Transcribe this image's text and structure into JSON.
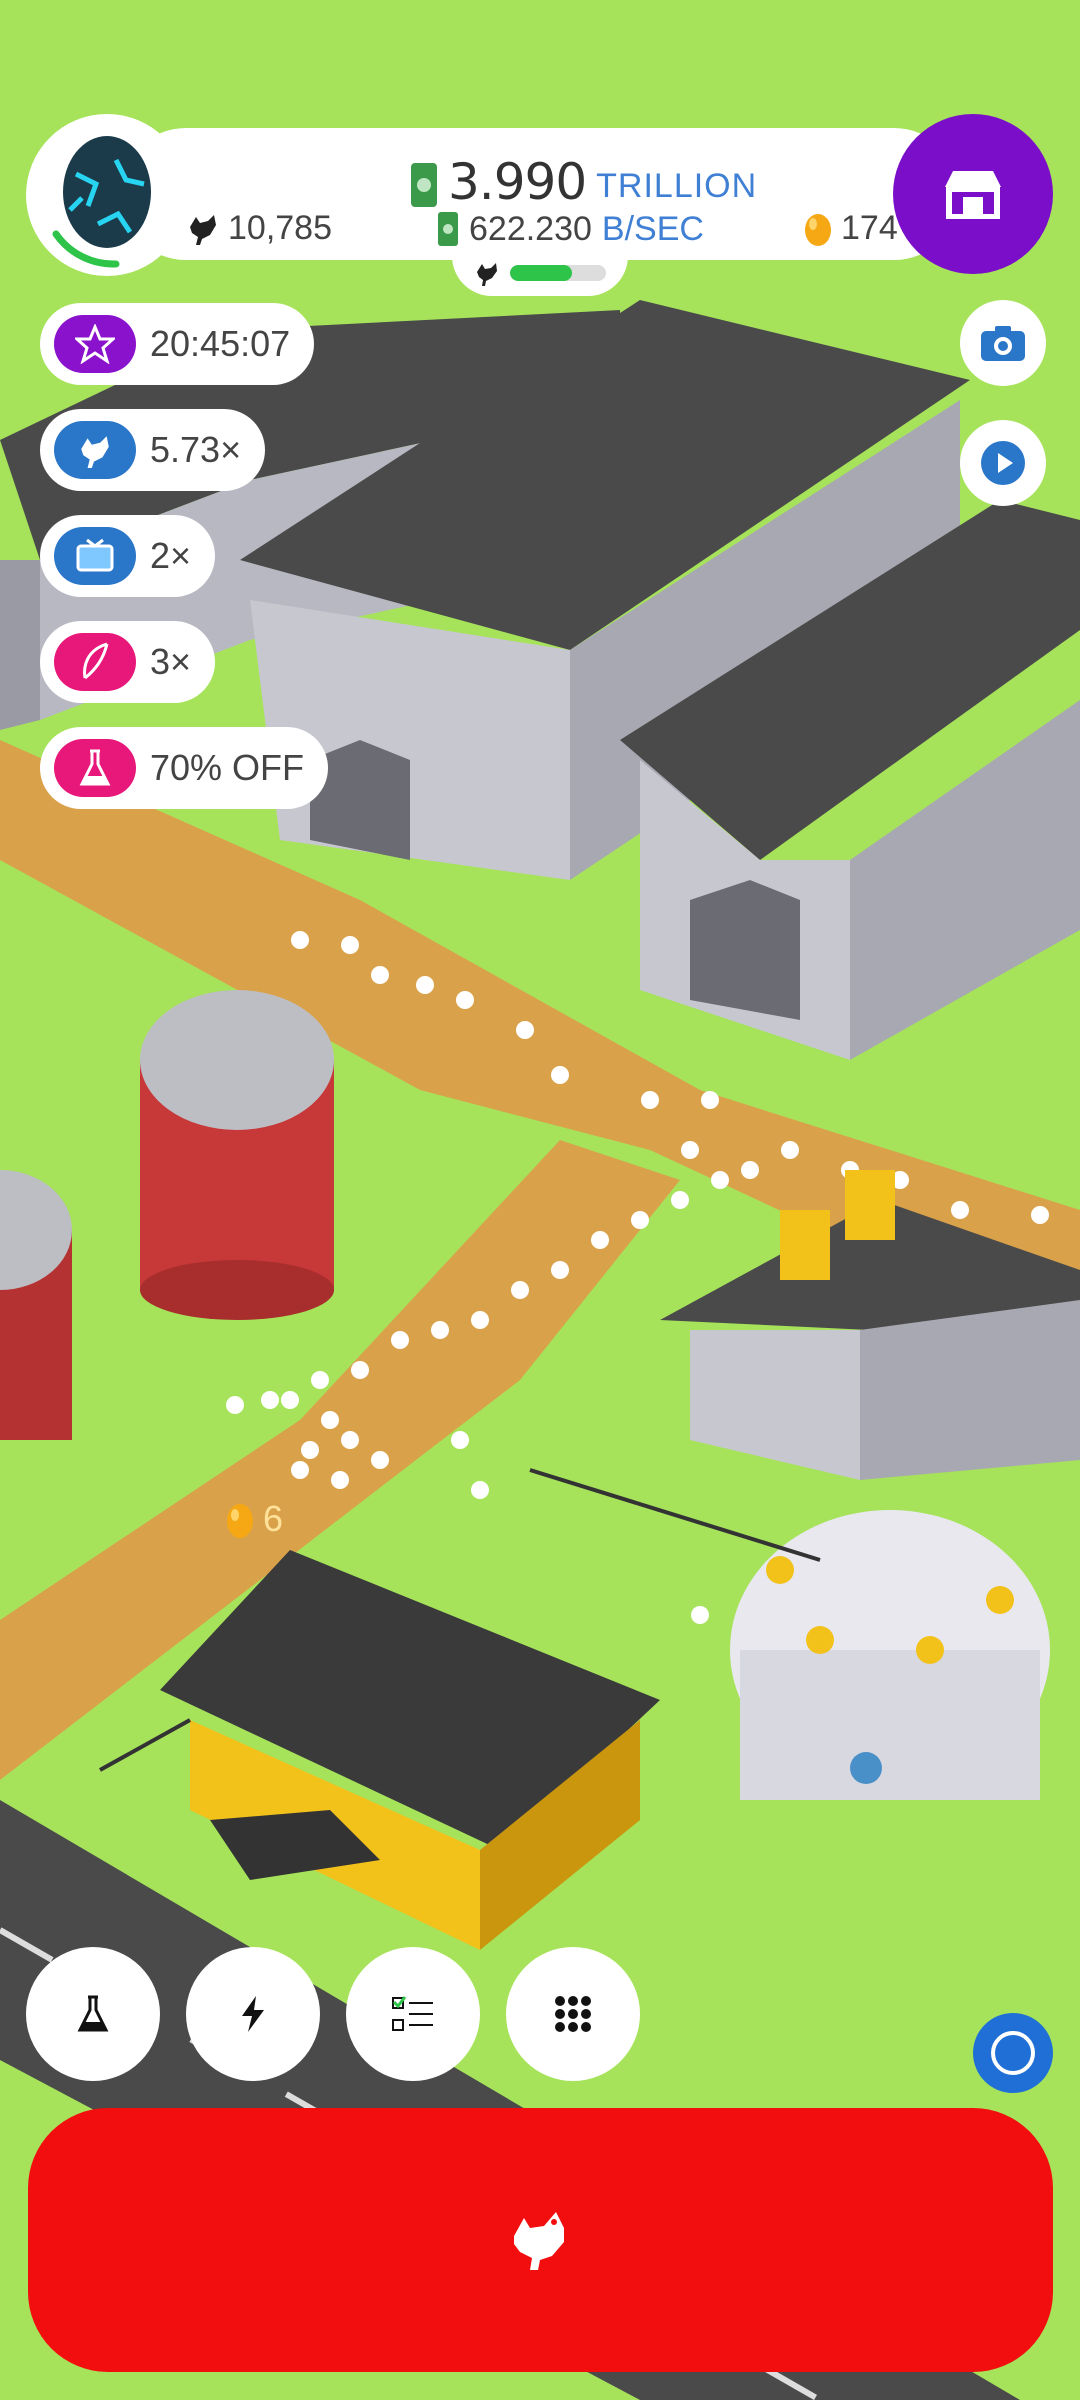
{
  "header": {
    "money_value": "3.990",
    "money_unit": "TRILLION",
    "rate_value": "622.230",
    "rate_unit": "B/SEC",
    "chicken_count": "10,785",
    "egg_count": "174",
    "hatchery_progress": 0.65
  },
  "boosts": [
    {
      "label": "20:45:07",
      "icon": "star-icon",
      "color": "#8b12cc"
    },
    {
      "label": "5.73×",
      "icon": "chicken-icon",
      "color": "#2a76c9"
    },
    {
      "label": "2×",
      "icon": "tv-icon",
      "color": "#2a76c9"
    },
    {
      "label": "3×",
      "icon": "quill-icon",
      "color": "#e8187a"
    },
    {
      "label": "70% OFF",
      "icon": "flask-icon",
      "color": "#e8187a"
    }
  ],
  "floating_egg": "6",
  "toolbar": {
    "buttons": [
      "research-flask-icon",
      "boost-lightning-icon",
      "missions-checklist-icon",
      "menu-grid-icon"
    ]
  },
  "colors": {
    "grass": "#a6e35b",
    "road": "#d9a24a",
    "shop": "#7b0ec9",
    "hatch_button": "#f20e0e",
    "accent_blue": "#3f7fd4"
  }
}
